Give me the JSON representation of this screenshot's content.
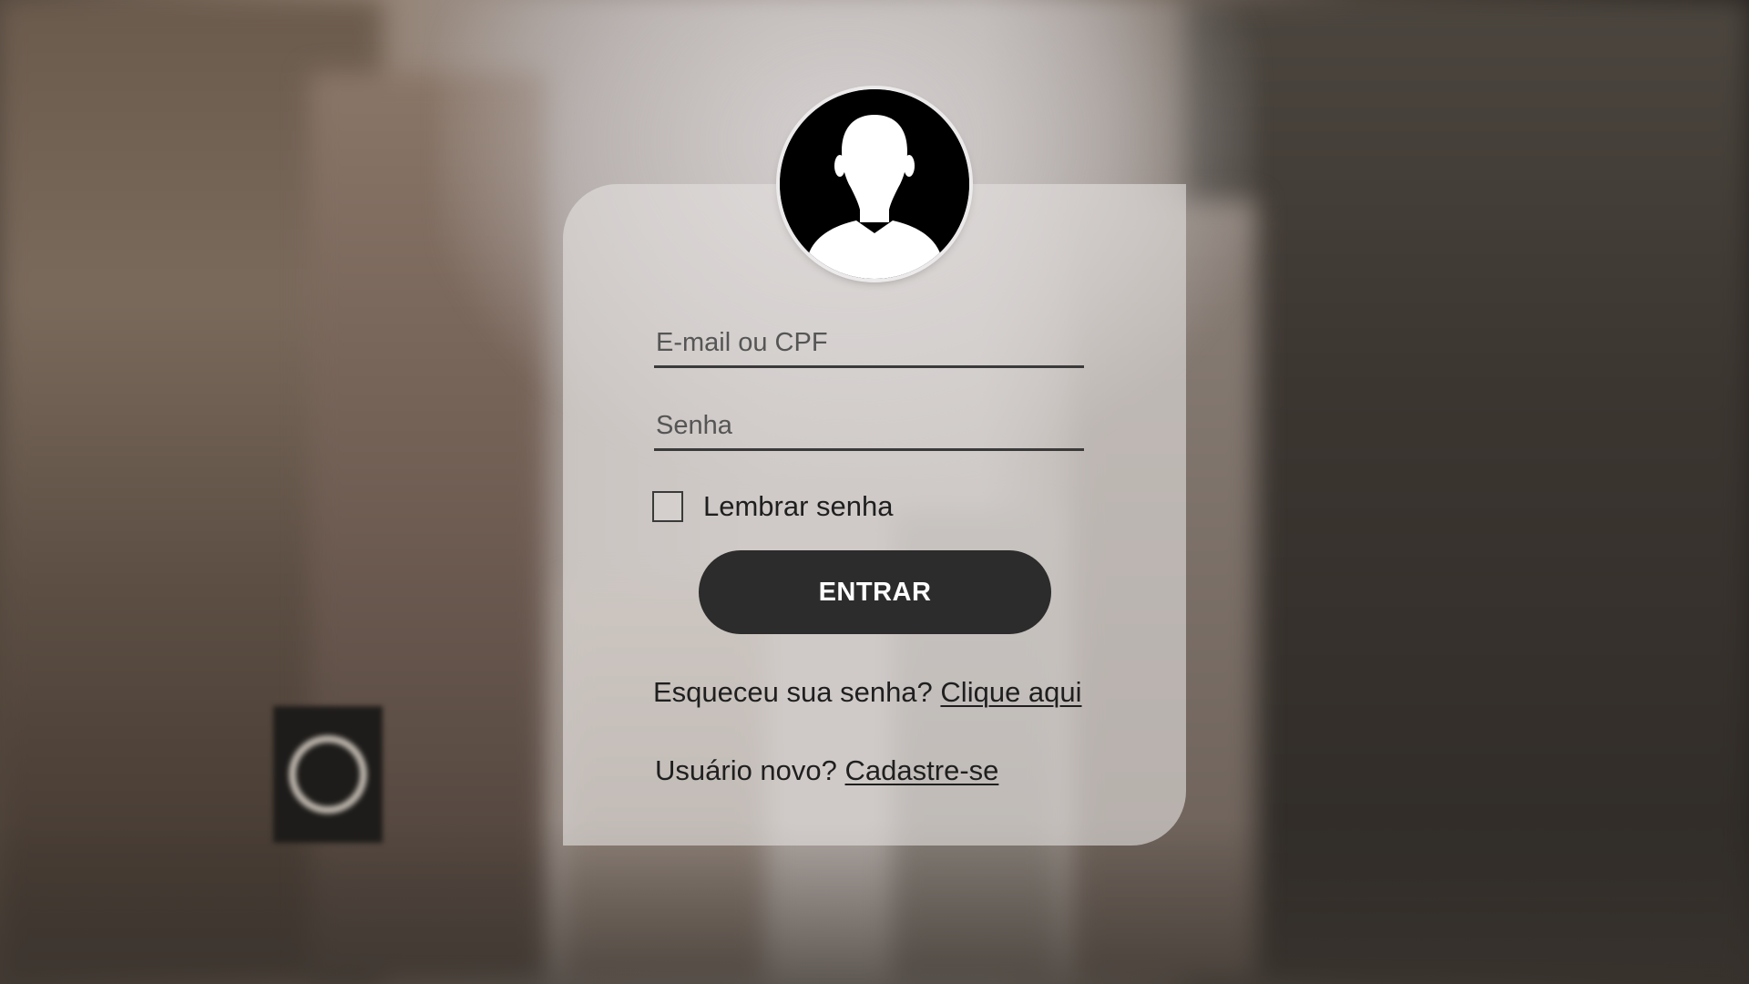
{
  "login": {
    "avatar_icon": "user-silhouette-icon",
    "email_placeholder": "E-mail ou CPF",
    "email_value": "",
    "password_placeholder": "Senha",
    "password_value": "",
    "remember_label": "Lembrar senha",
    "remember_checked": false,
    "submit_label": "ENTRAR",
    "forgot_text": "Esqueceu sua senha?",
    "forgot_link": "Clique aqui",
    "signup_text": "Usuário novo?",
    "signup_link": "Cadastre-se"
  },
  "colors": {
    "button_bg": "#2c2c2c",
    "button_text": "#ffffff",
    "card_bg": "rgba(228,224,222,0.62)",
    "avatar_bg": "#000000"
  }
}
